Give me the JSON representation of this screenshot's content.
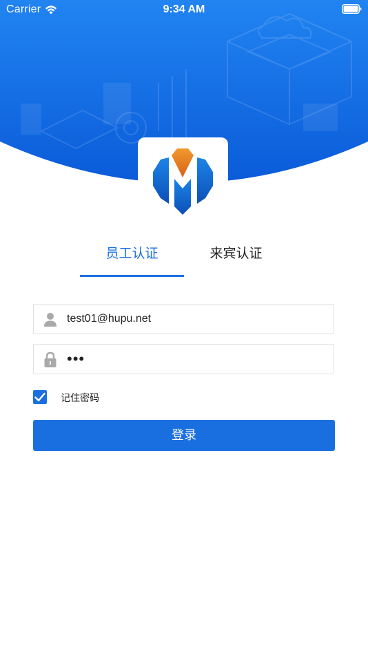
{
  "status_bar": {
    "carrier": "Carrier",
    "time": "9:34 AM"
  },
  "tabs": [
    {
      "label": "员工认证",
      "active": true
    },
    {
      "label": "来宾认证",
      "active": false
    }
  ],
  "form": {
    "username_value": "test01@hupu.net",
    "password_masked": "•••",
    "remember_label": "记住密码",
    "remember_checked": true,
    "login_label": "登录"
  },
  "colors": {
    "accent": "#1a6fe0",
    "hero_top": "#1f7ff0",
    "hero_bottom": "#0d62dc",
    "logo_orange": "#e97a1a",
    "logo_blue": "#1a78d8"
  },
  "icons": {
    "wifi": "wifi-icon",
    "battery": "battery-icon",
    "user": "user-icon",
    "lock": "lock-icon",
    "check": "check-icon"
  }
}
